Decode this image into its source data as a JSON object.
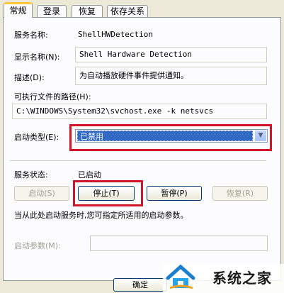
{
  "tabs": [
    "常规",
    "登录",
    "恢复",
    "依存关系"
  ],
  "general": {
    "service_name_label": "服务名称:",
    "service_name_value": "ShellHWDetection",
    "display_name_label": "显示名称(N):",
    "display_name_value": "Shell Hardware Detection",
    "description_label": "描述(D):",
    "description_value": "为自动播放硬件事件提供通知。",
    "exe_path_label": "可执行文件的路径(H):",
    "exe_path_value": "C:\\WINDOWS\\System32\\svchost.exe -k netsvcs",
    "startup_type_label": "启动类型(E):",
    "startup_type_value": "已禁用",
    "service_status_label": "服务状态:",
    "service_status_value": "已启动",
    "buttons": {
      "start": "启动(S)",
      "stop": "停止(T)",
      "pause": "暂停(P)",
      "resume": "恢复(R)"
    },
    "hint": "当从此处启动服务时,您可指定所适用的启动参数。",
    "start_params_label": "启动参数(M):",
    "start_params_value": ""
  },
  "footer": {
    "ok_label": "确定"
  },
  "watermark": {
    "text": "系统之家"
  },
  "icons": [
    "chevron-down-icon",
    "house-logo-icon"
  ]
}
